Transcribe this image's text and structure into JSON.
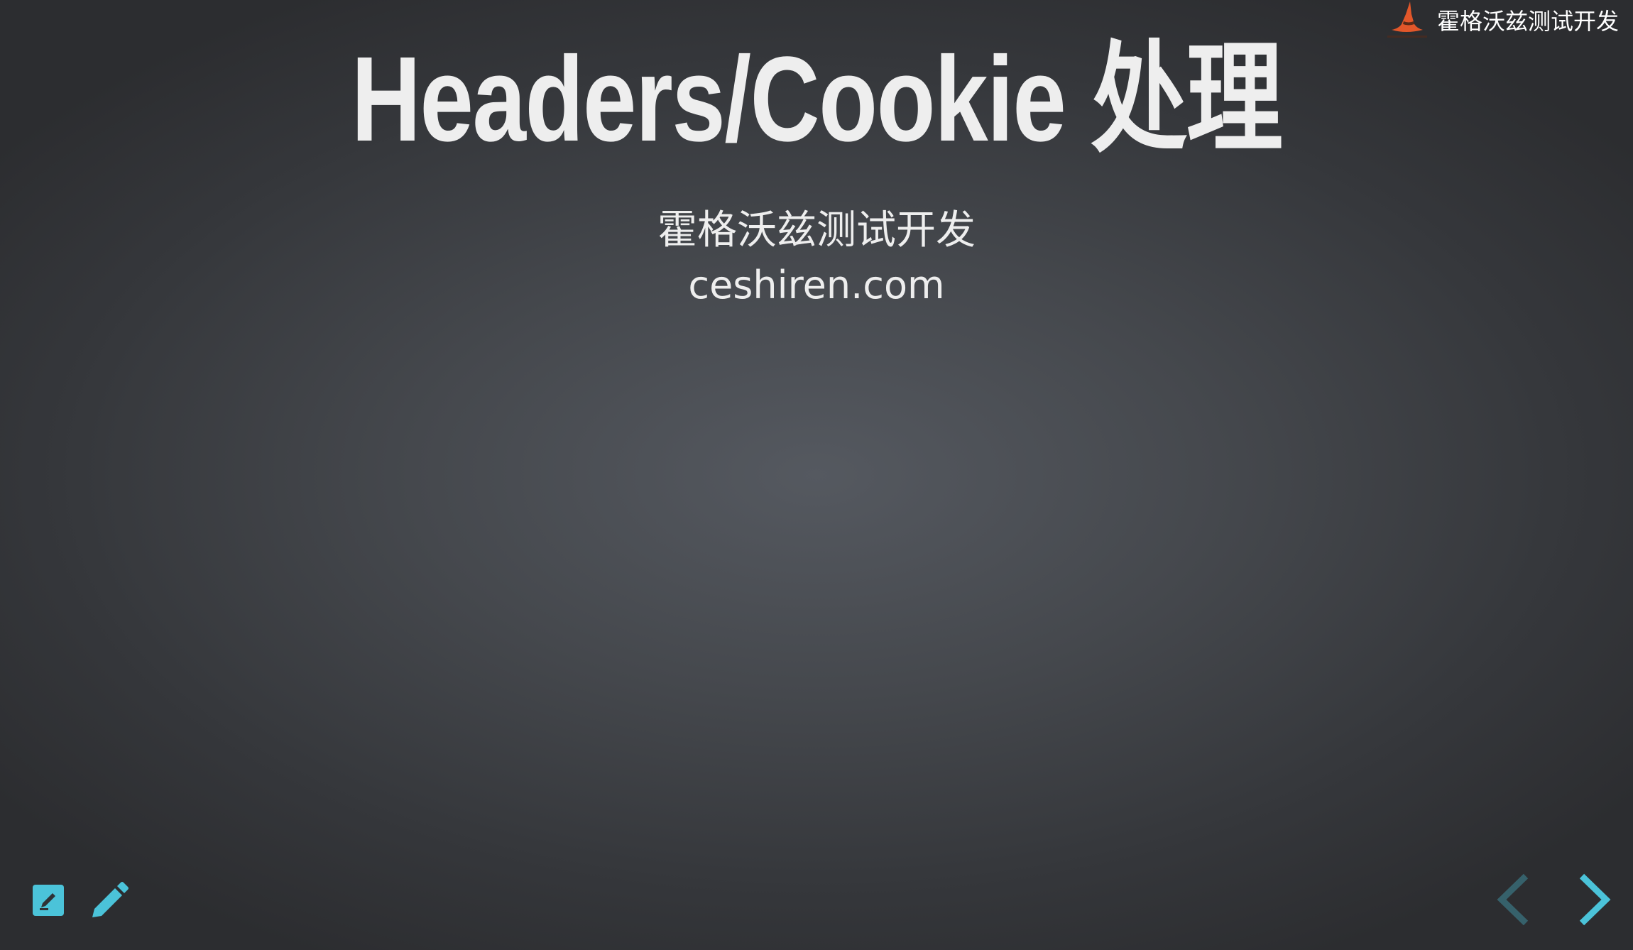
{
  "brand": {
    "name": "霍格沃兹测试开发",
    "logo_icon": "witch-hat-logo-icon",
    "logo_color": "#e2572a"
  },
  "slide": {
    "title": "Headers/Cookie 处理",
    "subtitle": "霍格沃兹测试开发",
    "url": "ceshiren.com"
  },
  "controls": {
    "accent_color": "#4bc3d9",
    "notes_icon": "notes-icon",
    "pen_icon": "pen-icon",
    "prev_icon": "chevron-left-icon",
    "next_icon": "chevron-right-icon"
  }
}
